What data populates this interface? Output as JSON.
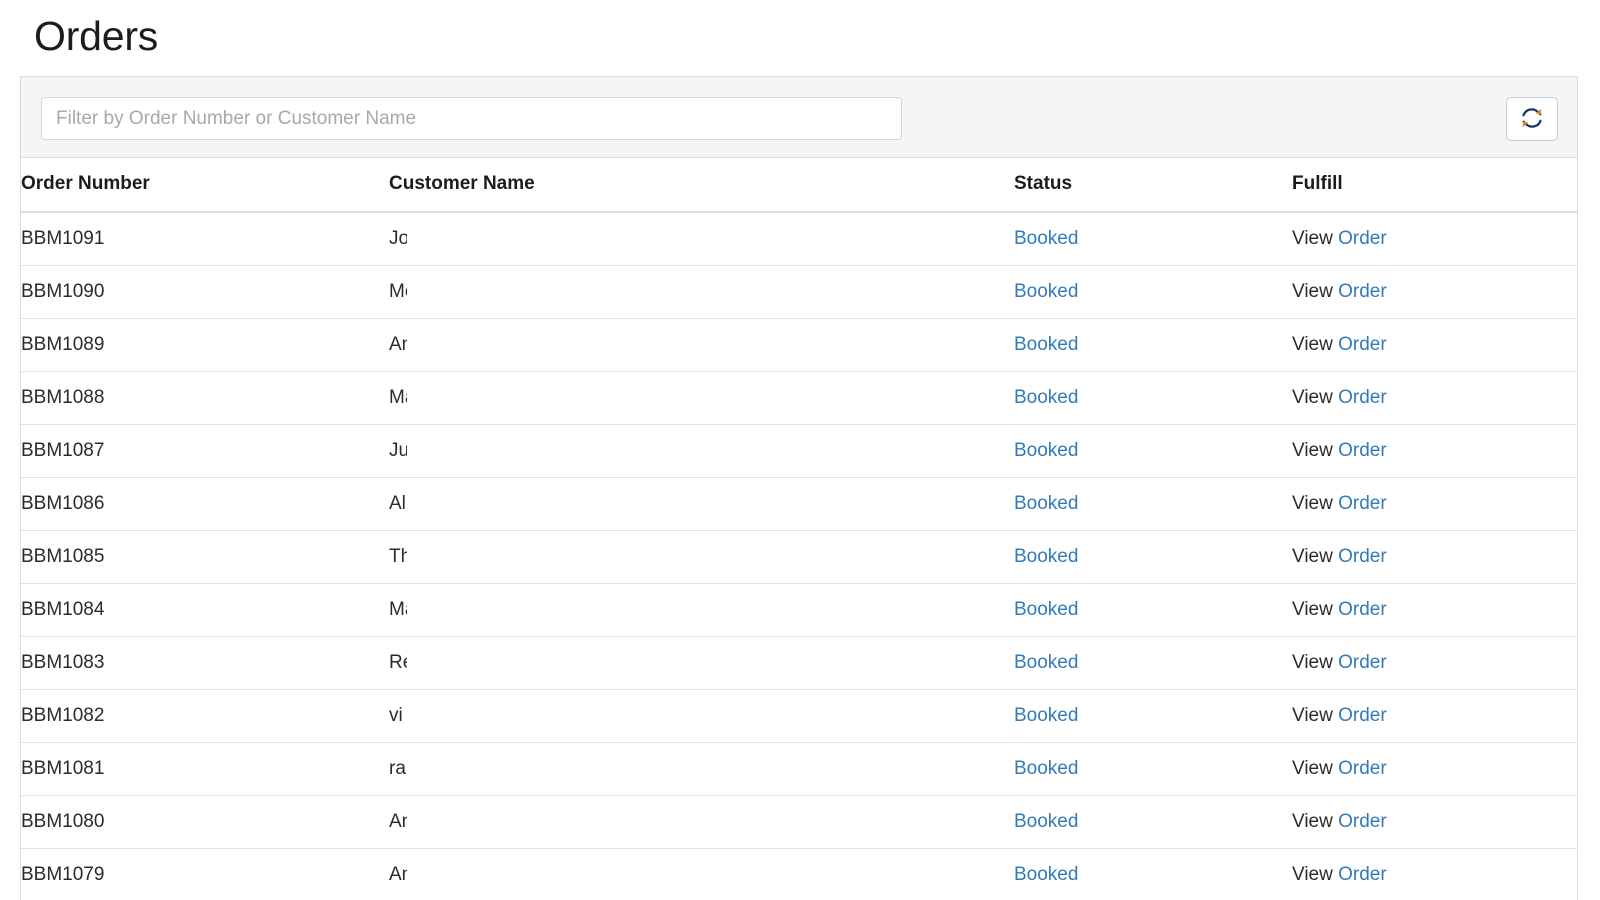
{
  "page": {
    "title": "Orders"
  },
  "toolbar": {
    "filter_placeholder": "Filter by Order Number or Customer Name",
    "filter_value": "",
    "refresh_icon": "refresh-icon",
    "refresh_label": "Refresh"
  },
  "table": {
    "columns": [
      {
        "key": "order_number",
        "label": "Order Number"
      },
      {
        "key": "customer_name",
        "label": "Customer Name"
      },
      {
        "key": "status",
        "label": "Status"
      },
      {
        "key": "fulfill",
        "label": "Fulfill"
      }
    ],
    "fulfill_prefix": "View",
    "fulfill_link": "Order",
    "rows": [
      {
        "order_number": "BBM1091",
        "customer_name": "Jo",
        "status": "Booked"
      },
      {
        "order_number": "BBM1090",
        "customer_name": "Me",
        "status": "Booked"
      },
      {
        "order_number": "BBM1089",
        "customer_name": "An",
        "status": "Booked"
      },
      {
        "order_number": "BBM1088",
        "customer_name": "Ma",
        "status": "Booked"
      },
      {
        "order_number": "BBM1087",
        "customer_name": "Ju",
        "status": "Booked"
      },
      {
        "order_number": "BBM1086",
        "customer_name": "Al",
        "status": "Booked"
      },
      {
        "order_number": "BBM1085",
        "customer_name": "Th",
        "status": "Booked"
      },
      {
        "order_number": "BBM1084",
        "customer_name": "Ma",
        "status": "Booked"
      },
      {
        "order_number": "BBM1083",
        "customer_name": "Re",
        "status": "Booked"
      },
      {
        "order_number": "BBM1082",
        "customer_name": "vi",
        "status": "Booked"
      },
      {
        "order_number": "BBM1081",
        "customer_name": "ra",
        "status": "Booked"
      },
      {
        "order_number": "BBM1080",
        "customer_name": "An",
        "status": "Booked"
      },
      {
        "order_number": "BBM1079",
        "customer_name": "An",
        "status": "Booked"
      }
    ]
  },
  "colors": {
    "link": "#337ab7",
    "text": "#2b2b2b",
    "heading": "#1c1c1c",
    "toolbar_bg": "#f5f5f5",
    "border": "#dddddd",
    "row_border": "#e3e3e3",
    "placeholder": "#a9a9a9",
    "refresh_icon_dark": "#1b365d",
    "refresh_icon_accent": "#e8871a"
  }
}
